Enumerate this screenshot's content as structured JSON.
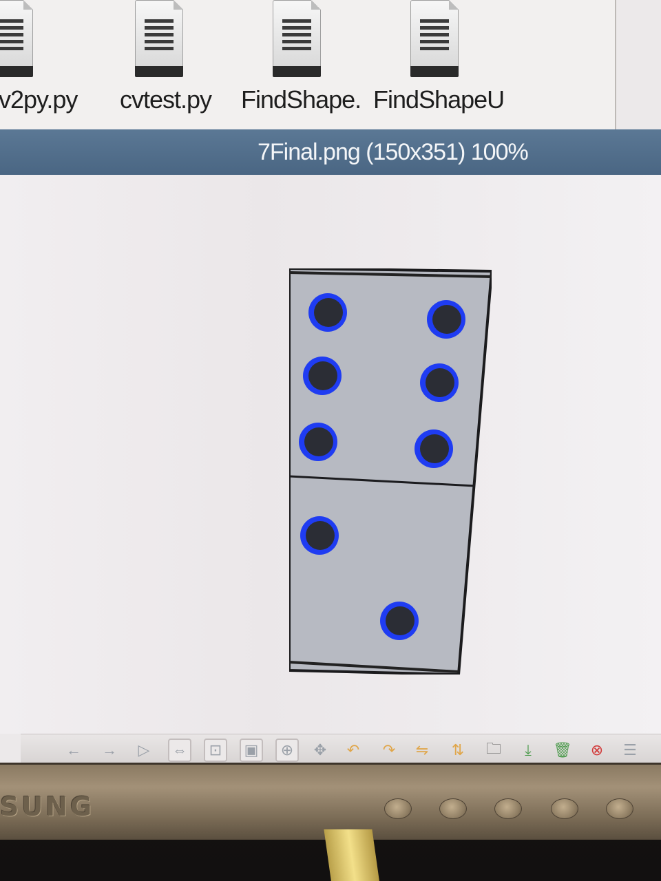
{
  "file_manager": {
    "files": [
      {
        "name": "v2py.py",
        "icon": "python-file-icon"
      },
      {
        "name": "cvtest.py",
        "icon": "python-file-icon"
      },
      {
        "name": "FindShape.",
        "icon": "python-file-icon"
      },
      {
        "name": "FindShapeU",
        "icon": "python-file-icon"
      }
    ]
  },
  "viewer": {
    "title": "7Final.png (150x351) 100%",
    "image": {
      "top_half_pips": 6,
      "bottom_half_pips": 2
    },
    "toolbar": [
      {
        "name": "back-arrow-icon",
        "glyph": "←"
      },
      {
        "name": "forward-arrow-icon",
        "glyph": "→"
      },
      {
        "name": "play-icon",
        "glyph": "▷"
      },
      {
        "name": "fit-width-icon",
        "glyph": "⇔"
      },
      {
        "name": "zoom-fit-icon",
        "glyph": "⊡"
      },
      {
        "name": "zoom-100-icon",
        "glyph": "▣"
      },
      {
        "name": "zoom-in-icon",
        "glyph": "⊕"
      },
      {
        "name": "fullscreen-icon",
        "glyph": "✥"
      },
      {
        "name": "rotate-left-icon",
        "glyph": "↶"
      },
      {
        "name": "rotate-right-icon",
        "glyph": "↷"
      },
      {
        "name": "flip-horizontal-icon",
        "glyph": "⇋"
      },
      {
        "name": "flip-vertical-icon",
        "glyph": "⇅"
      },
      {
        "name": "open-folder-icon",
        "glyph": "🗀"
      },
      {
        "name": "save-icon",
        "glyph": "⤓"
      },
      {
        "name": "delete-icon",
        "glyph": "🗑"
      },
      {
        "name": "close-icon",
        "glyph": "⊗"
      },
      {
        "name": "preferences-icon",
        "glyph": "☰"
      }
    ]
  },
  "monitor": {
    "brand": "SUNG"
  },
  "colors": {
    "titlebar": "#4f6b88",
    "pip_fill": "#2b2d35",
    "pip_ring": "#1f3cf2",
    "domino_face": "#b7bac2"
  }
}
